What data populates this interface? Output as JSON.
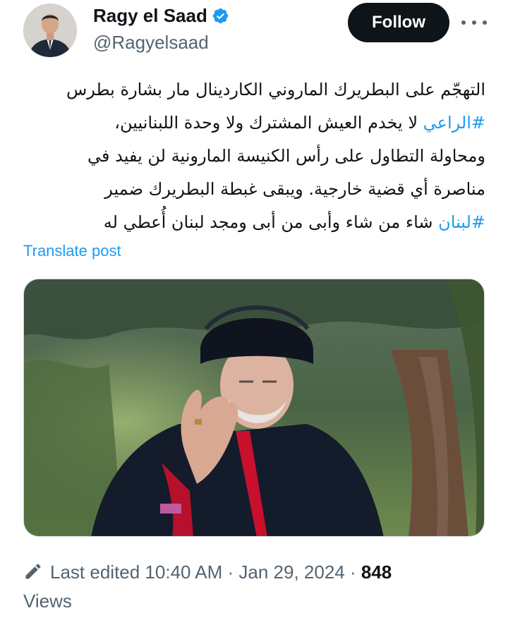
{
  "author": {
    "name": "Ragy el Saad",
    "handle": "@Ragyelsaad",
    "verified_icon": "verified-badge-icon"
  },
  "actions": {
    "follow_label": "Follow",
    "more_icon": "more-dots-icon"
  },
  "tweet": {
    "line1": "التهجّم على البطريرك الماروني الكاردينال مار بشارة بطرس",
    "line2_hashtag": "#الراعي",
    "line2_rest": " لا يخدم العيش المشترك ولا وحدة اللبنانيين،",
    "line3": "ومحاولة التطاول على رأس الكنيسة المارونية لن يفيد في",
    "line4": "مناصرة أي قضية خارجية. ويبقى غبطة البطريرك ضمير",
    "line5_hashtag": "#لبنان",
    "line5_rest": " شاء من شاء وأبى من أبى ومجد لبنان أُعطي له"
  },
  "translate_label": "Translate post",
  "footer": {
    "edited_text": "Last edited 10:40 AM · Jan 29, 2024 · ",
    "views_count": "848",
    "views_label": "Views"
  },
  "colors": {
    "accent": "#1d9bf0",
    "text": "#0f1419",
    "secondary": "#536471",
    "follow_bg": "#0f1419"
  }
}
